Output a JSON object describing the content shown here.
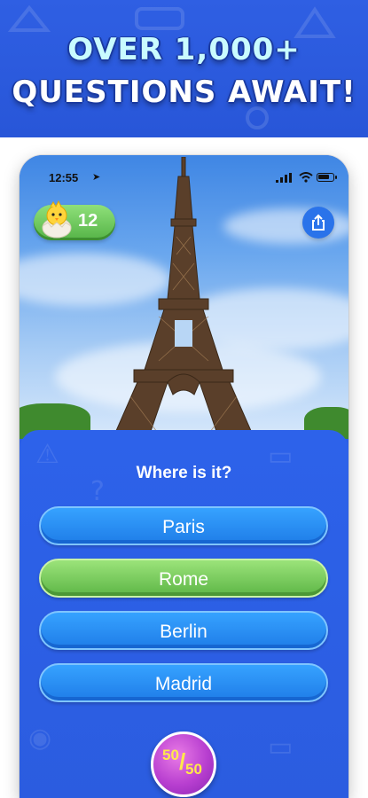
{
  "banner": {
    "line1": "OVER 1,000+",
    "line2": "QUESTIONS AWAIT!"
  },
  "status_bar": {
    "time": "12:55",
    "location_icon": "location-arrow-icon",
    "signal_icon": "cellular-signal-icon",
    "wifi_icon": "wifi-icon",
    "battery_icon": "battery-icon"
  },
  "header": {
    "coins_count": "12",
    "coin_icon": "chick-egg-icon",
    "share_icon": "share-icon"
  },
  "quiz": {
    "question": "Where is it?",
    "answers": [
      {
        "label": "Paris",
        "state": "default"
      },
      {
        "label": "Rome",
        "state": "highlighted"
      },
      {
        "label": "Berlin",
        "state": "default"
      },
      {
        "label": "Madrid",
        "state": "default"
      }
    ],
    "lifeline": {
      "top": "50",
      "bottom": "50"
    }
  },
  "colors": {
    "banner_bg": "#2f5fe3",
    "panel_bg": "#2d62ea",
    "answer_blue": "#1f7de8",
    "answer_green": "#5db646",
    "lifeline_purple": "#b83fd0",
    "lifeline_text": "#ffe84a"
  }
}
